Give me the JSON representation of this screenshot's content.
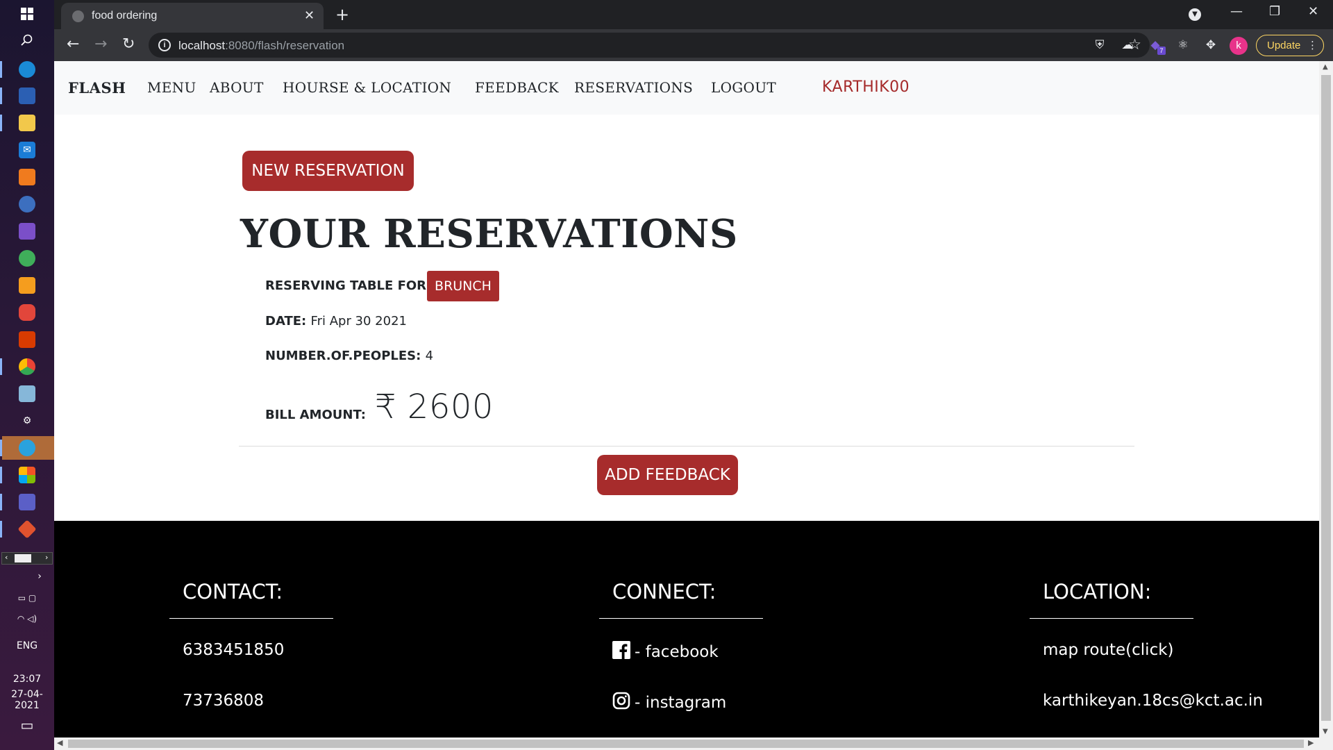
{
  "browser": {
    "tab_title": "food ordering",
    "url_host": "localhost",
    "url_path": ":8080/flash/reservation",
    "update_label": "Update",
    "profile_initial": "k",
    "extension_badge": "7"
  },
  "taskbar": {
    "language": "ENG",
    "time": "23:07",
    "date": "27-04-2021"
  },
  "nav": {
    "brand": "FLASH",
    "items": [
      "MENU",
      "ABOUT",
      "HOURSE & LOCATION",
      "FEEDBACK",
      "RESERVATIONS",
      "LOGOUT"
    ],
    "user": "KARTHIK00"
  },
  "main": {
    "new_reservation_label": "NEW RESERVATION",
    "heading": "YOUR RESERVATIONS",
    "reserving_label": "RESERVING TABLE FOR :",
    "reserving_value": "BRUNCH",
    "date_label": "DATE:",
    "date_value": "Fri Apr 30 2021",
    "people_label": "NUMBER.OF.PEOPLES:",
    "people_value": "4",
    "bill_label": "BILL AMOUNT:",
    "bill_value": "₹ 2600",
    "add_feedback_label": "ADD FEEDBACK"
  },
  "footer": {
    "contact": {
      "title": "CONTACT:",
      "lines": [
        "6383451850",
        "73736808"
      ]
    },
    "connect": {
      "title": "CONNECT:",
      "facebook": "- facebook",
      "instagram": "- instagram"
    },
    "location": {
      "title": "LOCATION:",
      "lines": [
        "map route(click)",
        "karthikeyan.18cs@kct.ac.in"
      ]
    }
  },
  "colors": {
    "accent": "#a72c2c",
    "user_name": "#a52a2a",
    "footer_bg": "#000000",
    "navbar_bg": "#f8f9fa"
  }
}
